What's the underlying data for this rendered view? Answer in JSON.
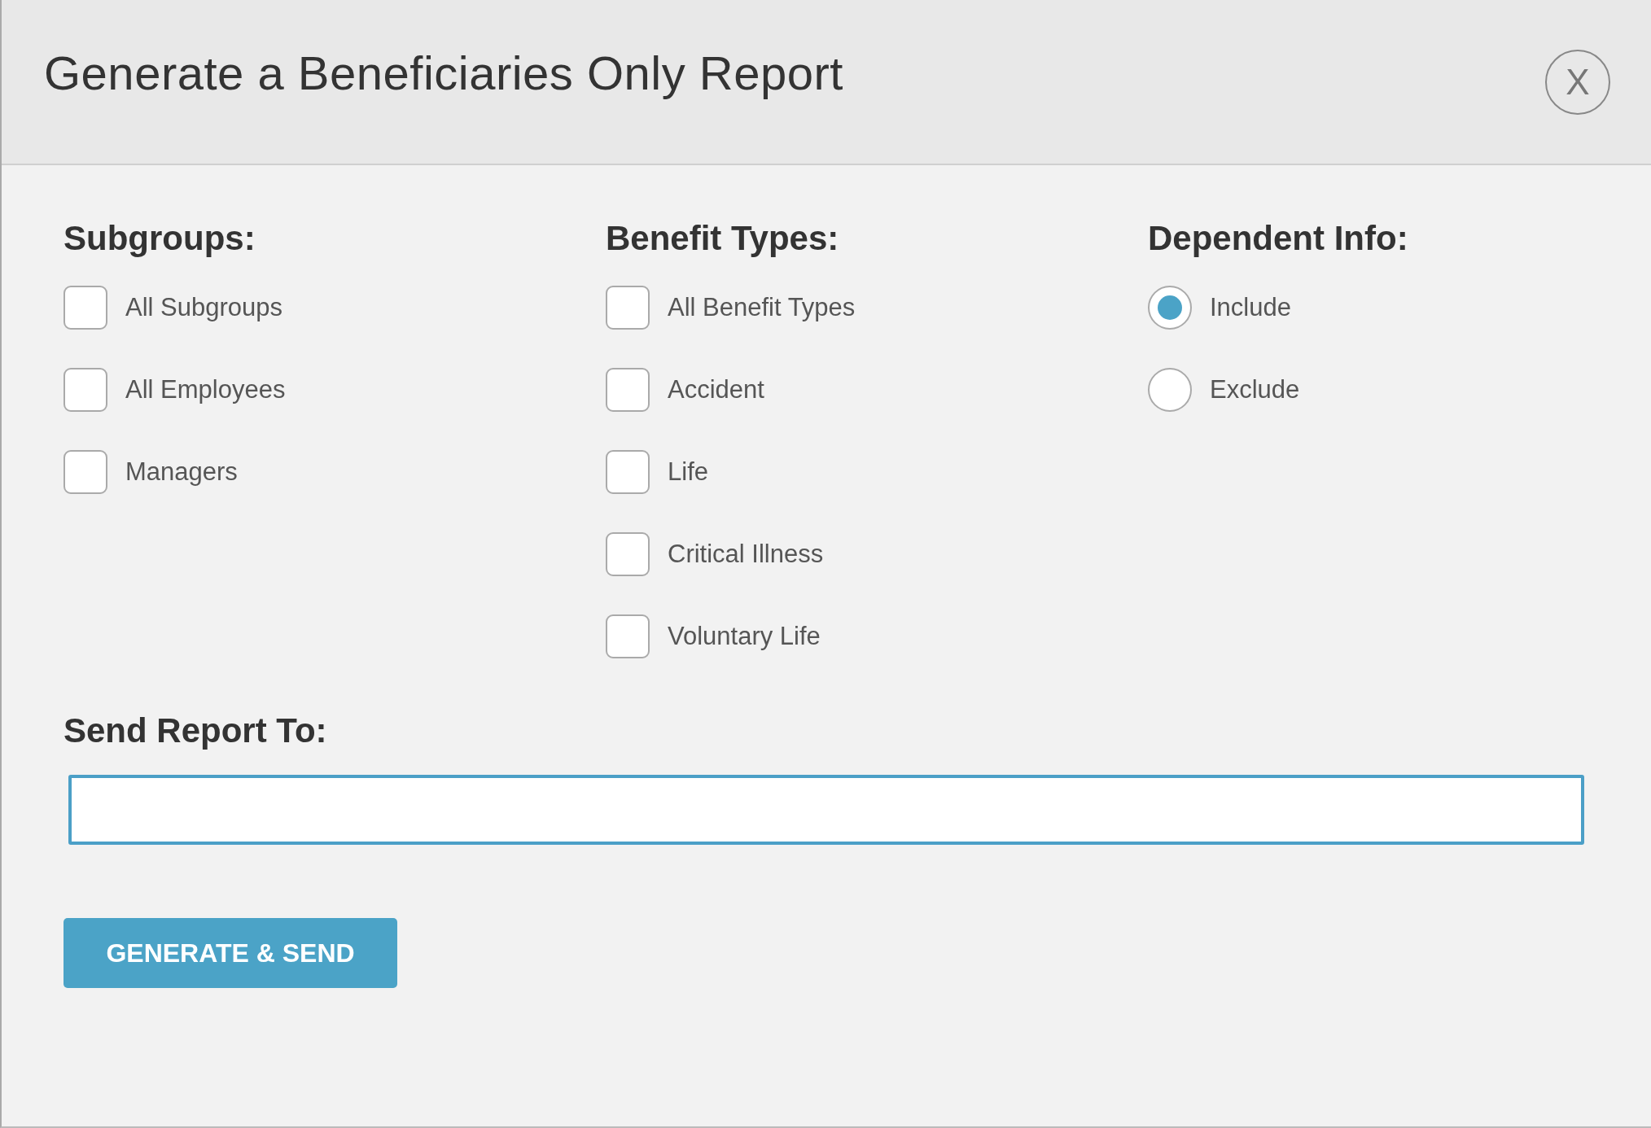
{
  "dialog": {
    "title": "Generate a Beneficiaries Only Report",
    "close_label": "X"
  },
  "sections": [
    {
      "heading": "Subgroups:",
      "kind": "checkbox",
      "options": [
        {
          "label": "All Subgroups",
          "checked": false
        },
        {
          "label": "All Employees",
          "checked": false
        },
        {
          "label": "Managers",
          "checked": false
        }
      ]
    },
    {
      "heading": "Benefit Types:",
      "kind": "checkbox",
      "options": [
        {
          "label": "All Benefit Types",
          "checked": false
        },
        {
          "label": "Accident",
          "checked": false
        },
        {
          "label": "Life",
          "checked": false
        },
        {
          "label": "Critical Illness",
          "checked": false
        },
        {
          "label": "Voluntary Life",
          "checked": false
        }
      ]
    },
    {
      "heading": "Dependent Info:",
      "kind": "radio",
      "options": [
        {
          "label": "Include",
          "selected": true
        },
        {
          "label": "Exclude",
          "selected": false
        }
      ]
    }
  ],
  "send_to": {
    "heading": "Send Report To:"
  },
  "submit_button": "GENERATE & SEND"
}
